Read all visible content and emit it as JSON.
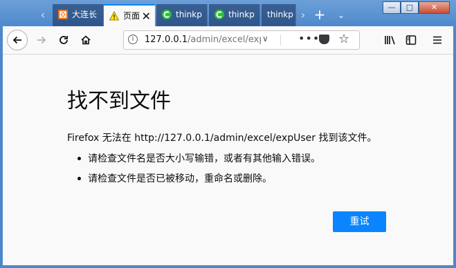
{
  "tabs": [
    {
      "label": "大连长",
      "icon": "orange-app-icon",
      "active": false
    },
    {
      "label": "页面",
      "icon": "warning-icon",
      "active": true
    },
    {
      "label": "thinkp",
      "icon": "green-c-icon",
      "active": false
    },
    {
      "label": "thinkp",
      "icon": "green-c-icon",
      "active": false
    },
    {
      "label": "thinkp",
      "icon": "none",
      "active": false
    }
  ],
  "toolbar": {
    "url_host": "127.0.0.1",
    "url_path": "/admin/excel/expUs",
    "more_label": "•••"
  },
  "error_page": {
    "title": "找不到文件",
    "message": "Firefox 无法在 http://127.0.0.1/admin/excel/expUser 找到该文件。",
    "bullets": [
      "请检查文件名是否大小写输错，或者有其他输入错误。",
      "请检查文件是否已被移动，重命名或删除。"
    ],
    "retry_label": "重试"
  },
  "colors": {
    "accent": "#0a84ff",
    "titlebar": "#4d88cb",
    "tab_active_bg": "#f9f9fa"
  }
}
